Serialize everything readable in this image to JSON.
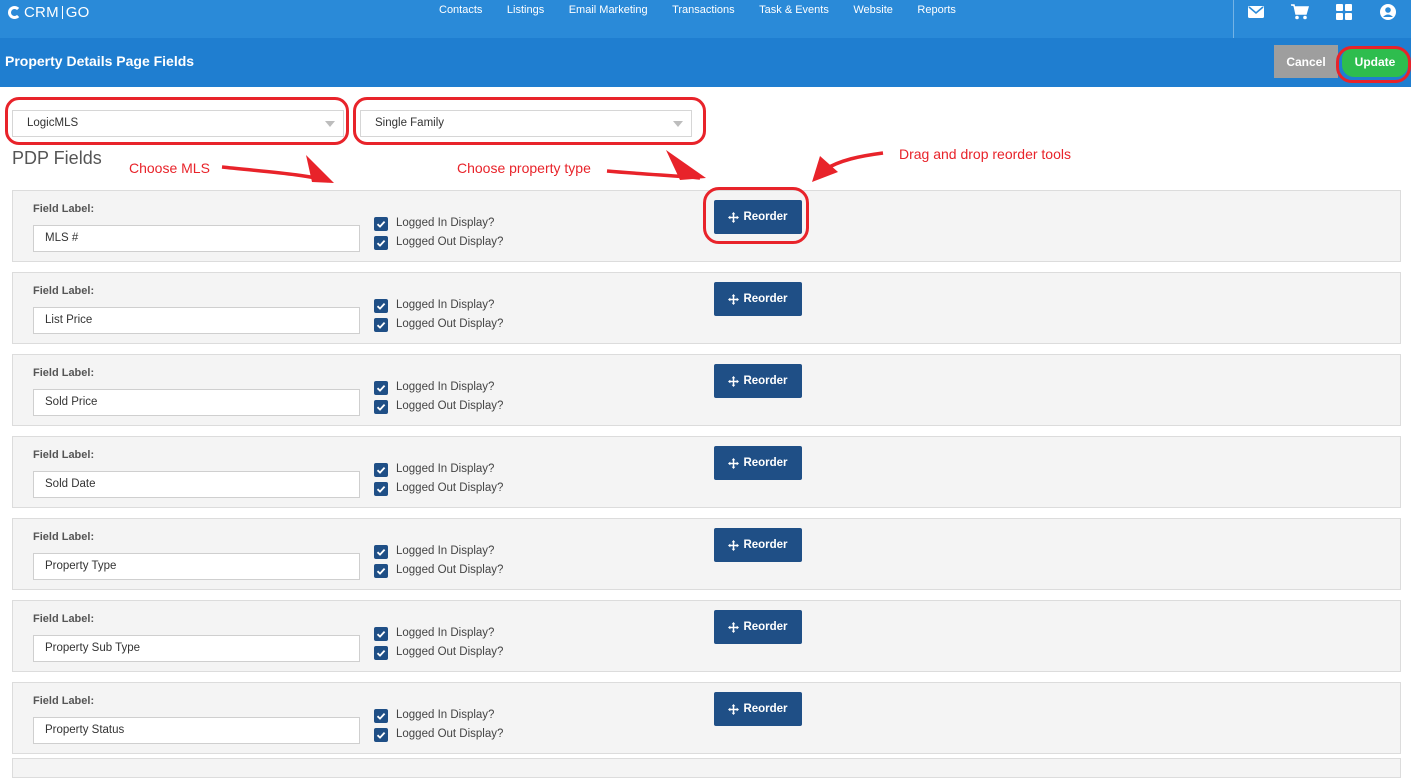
{
  "app": {
    "logo_left": "CRM",
    "logo_right": "GO"
  },
  "nav": {
    "items": [
      "Contacts",
      "Listings",
      "Email Marketing",
      "Transactions",
      "Task & Events",
      "Website",
      "Reports"
    ],
    "icons": [
      "envelope-icon",
      "cart-icon",
      "grid-icon",
      "user-icon"
    ]
  },
  "header": {
    "title": "Property Details Page Fields",
    "cancel_label": "Cancel",
    "update_label": "Update"
  },
  "filters": {
    "mls_value": "LogicMLS",
    "property_type_value": "Single Family"
  },
  "section": {
    "title": "PDP Fields"
  },
  "annotations": {
    "choose_mls": "Choose MLS",
    "choose_property_type": "Choose property type",
    "drag_drop": "Drag and drop reorder tools"
  },
  "fields": {
    "label_caption": "Field Label:",
    "logged_in_label": "Logged In Display?",
    "logged_out_label": "Logged Out Display?",
    "reorder_label": "Reorder",
    "items": [
      {
        "value": "MLS #",
        "logged_in": true,
        "logged_out": true
      },
      {
        "value": "List Price",
        "logged_in": true,
        "logged_out": true
      },
      {
        "value": "Sold Price",
        "logged_in": true,
        "logged_out": true
      },
      {
        "value": "Sold Date",
        "logged_in": true,
        "logged_out": true
      },
      {
        "value": "Property Type",
        "logged_in": true,
        "logged_out": true
      },
      {
        "value": "Property Sub Type",
        "logged_in": true,
        "logged_out": true
      },
      {
        "value": "Property Status",
        "logged_in": true,
        "logged_out": true
      }
    ]
  },
  "colors": {
    "nav": "#2a8ad8",
    "subheader": "#1f7ed0",
    "primary_button": "#1f4f86",
    "update": "#2ebd4e",
    "cancel": "#9e9e9e",
    "annotation": "#e8232a"
  }
}
